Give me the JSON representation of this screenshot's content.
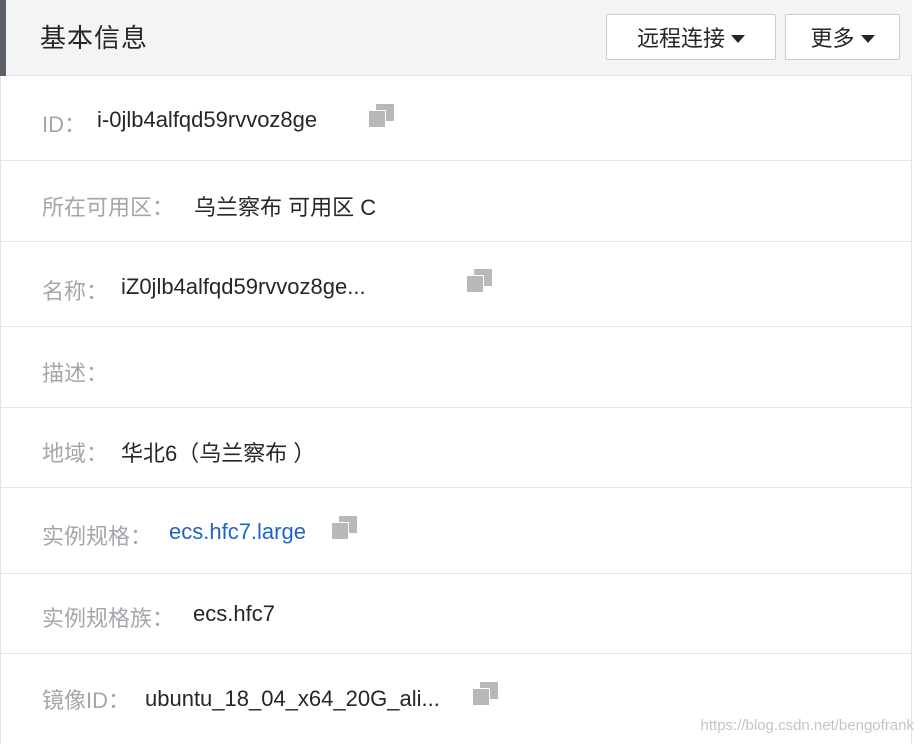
{
  "header": {
    "title": "基本信息",
    "remote_connect_label": "远程连接",
    "more_label": "更多"
  },
  "rows": {
    "id": {
      "label": "ID：",
      "value": "i-0jlb4alfqd59rvvoz8ge"
    },
    "zone": {
      "label": "所在可用区：",
      "value": "乌兰察布 可用区 C"
    },
    "name": {
      "label": "名称：",
      "value": "iZ0jlb4alfqd59rvvoz8ge..."
    },
    "description": {
      "label": "描述：",
      "value": ""
    },
    "region": {
      "label": "地域：",
      "value": "华北6（乌兰察布 ）"
    },
    "instance_type": {
      "label": "实例规格：",
      "value": "ecs.hfc7.large"
    },
    "instance_family": {
      "label": "实例规格族：",
      "value": "ecs.hfc7"
    },
    "image_id": {
      "label": "镜像ID：",
      "value": "ubuntu_18_04_x64_20G_ali..."
    }
  },
  "watermark": "https://blog.csdn.net/bengofrank",
  "colors": {
    "link": "#1d65c4",
    "label": "#a3a6ab",
    "header_bg": "#f3f4f6",
    "accent": "#5c5f66"
  }
}
